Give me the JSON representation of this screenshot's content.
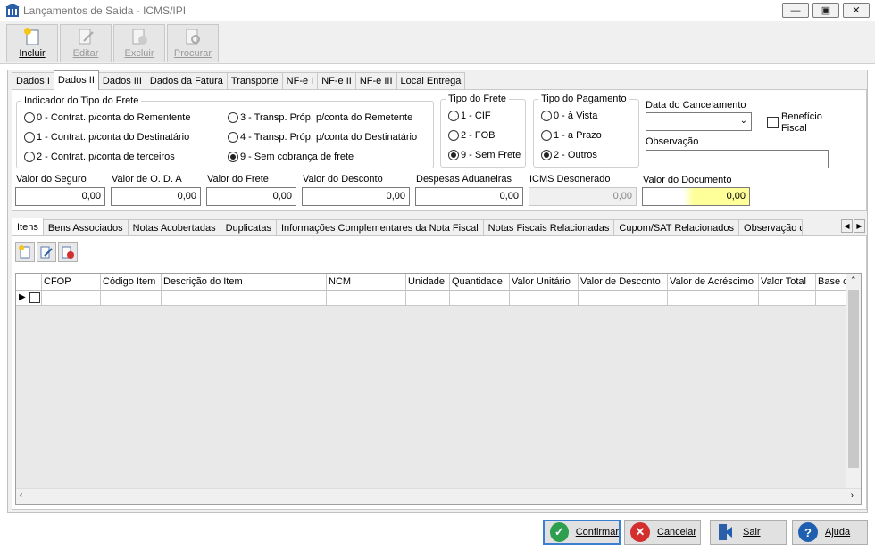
{
  "window": {
    "title": "Lançamentos de Saída - ICMS/IPI",
    "minimize": "▭",
    "maximize": "▣",
    "close": "✕"
  },
  "toolbar": {
    "incluir": "Incluir",
    "editar": "Editar",
    "excluir": "Excluir",
    "procurar": "Procurar"
  },
  "tabs_top": [
    "Dados I",
    "Dados II",
    "Dados III",
    "Dados da Fatura",
    "Transporte",
    "NF-e I",
    "NF-e II",
    "NF-e III",
    "Local Entrega"
  ],
  "frete_indicador": {
    "title": "Indicador do Tipo do Frete",
    "options": [
      "0 - Contrat. p/conta do Rementente",
      "1 - Contrat. p/conta do Destinatário",
      "2 - Contrat. p/conta de terceiros",
      "3 - Transp. Próp. p/conta do Remetente",
      "4 - Transp. Próp. p/conta do Destinatário",
      "9 - Sem cobrança de frete"
    ],
    "selected": 5
  },
  "tipo_frete": {
    "title": "Tipo do Frete",
    "options": [
      "1 - CIF",
      "2 - FOB",
      "9 - Sem Frete"
    ],
    "selected": 2
  },
  "tipo_pagamento": {
    "title": "Tipo do Pagamento",
    "options": [
      "0 - à Vista",
      "1 - a Prazo",
      "2 - Outros"
    ],
    "selected": 2
  },
  "cancelamento": {
    "data_label": "Data do Cancelamento",
    "data_value": "",
    "beneficio_label_1": "Benefício",
    "beneficio_label_2": "Fiscal",
    "observacao_label": "Observação",
    "observacao_value": ""
  },
  "valores": {
    "seguro_label": "Valor do Seguro",
    "seguro": "0,00",
    "oda_label": "Valor de O. D. A",
    "oda": "0,00",
    "frete_label": "Valor do Frete",
    "frete": "0,00",
    "desconto_label": "Valor do Desconto",
    "desconto": "0,00",
    "aduaneiras_label": "Despesas Aduaneiras",
    "aduaneiras": "0,00",
    "icms_label": "ICMS Desonerado",
    "icms": "0,00",
    "documento_label": "Valor do Documento",
    "documento": "0,00"
  },
  "tabs_bottom": [
    "Itens",
    "Bens Associados",
    "Notas Acobertadas",
    "Duplicatas",
    "Informações Complementares da Nota Fiscal",
    "Notas Fiscais Relacionadas",
    "Cupom/SAT Relacionados",
    "Observação d"
  ],
  "grid": {
    "columns": [
      "",
      "CFOP",
      "Código Item",
      "Descrição do Item",
      "NCM",
      "Unidade",
      "Quantidade",
      "Valor Unitário",
      "Valor de Desconto",
      "Valor de Acréscimo",
      "Valor Total",
      "Base c"
    ]
  },
  "buttons": {
    "confirmar": "Confirmar",
    "cancelar": "Cancelar",
    "sair": "Sair",
    "ajuda": "Ajuda"
  },
  "colors": {
    "highlight": "#ffff99",
    "confirm": "#2e9e4f",
    "cancel": "#d32f2f",
    "help": "#1f5fb0",
    "arrow": "#e02020"
  }
}
